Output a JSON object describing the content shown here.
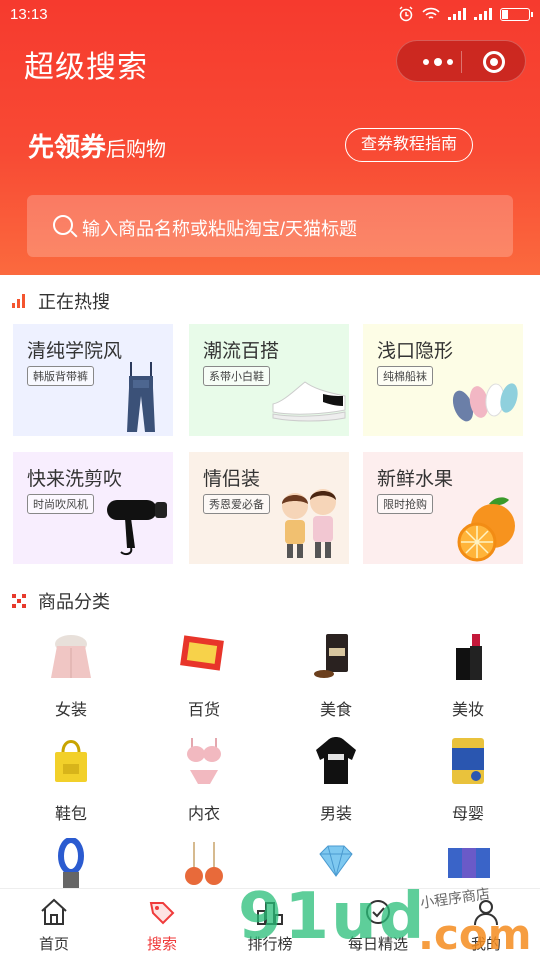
{
  "status": {
    "time": "13:13"
  },
  "header": {
    "title": "超级搜索",
    "coupon_strong": "先领券",
    "coupon_weak": "后购物",
    "guide_label": "查券教程指南"
  },
  "search": {
    "placeholder": "输入商品名称或粘贴淘宝/天猫标题"
  },
  "hot": {
    "title": "正在热搜",
    "cards": [
      {
        "title": "清纯学院风",
        "tag": "韩版背带裤",
        "bg": "#eef1ff"
      },
      {
        "title": "潮流百搭",
        "tag": "系带小白鞋",
        "bg": "#e8fbe9"
      },
      {
        "title": "浅口隐形",
        "tag": "纯棉船袜",
        "bg": "#fdfde6"
      },
      {
        "title": "快来洗剪吹",
        "tag": "时尚吹风机",
        "bg": "#f8eefe"
      },
      {
        "title": "情侣装",
        "tag": "秀恩爱必备",
        "bg": "#fbf1e8"
      },
      {
        "title": "新鲜水果",
        "tag": "限时抢购",
        "bg": "#fdeeee"
      }
    ]
  },
  "categories": {
    "title": "商品分类",
    "items": [
      {
        "label": "女装",
        "icon": "coat-icon"
      },
      {
        "label": "百货",
        "icon": "goods-icon"
      },
      {
        "label": "美食",
        "icon": "coffee-bag-icon"
      },
      {
        "label": "美妆",
        "icon": "lipstick-icon"
      },
      {
        "label": "鞋包",
        "icon": "bag-icon"
      },
      {
        "label": "内衣",
        "icon": "lingerie-icon"
      },
      {
        "label": "男装",
        "icon": "hoodie-icon"
      },
      {
        "label": "母婴",
        "icon": "milk-can-icon"
      },
      {
        "label": "",
        "icon": "fan-icon"
      },
      {
        "label": "",
        "icon": "earring-icon"
      },
      {
        "label": "",
        "icon": "diamond-icon"
      },
      {
        "label": "",
        "icon": "box-icon"
      }
    ]
  },
  "tabbar": {
    "tabs": [
      {
        "label": "首页",
        "icon": "home-icon"
      },
      {
        "label": "搜索",
        "icon": "tag-icon",
        "active": true
      },
      {
        "label": "排行榜",
        "icon": "rank-icon"
      },
      {
        "label": "每日精选",
        "icon": "daily-icon"
      },
      {
        "label": "我的",
        "icon": "user-icon"
      }
    ]
  },
  "watermark": {
    "text": "91ud",
    "suffix": ".com",
    "hand": "小程序商店"
  },
  "colors": {
    "brand": "#f63a2e",
    "active_tab": "#ef3b3b"
  }
}
